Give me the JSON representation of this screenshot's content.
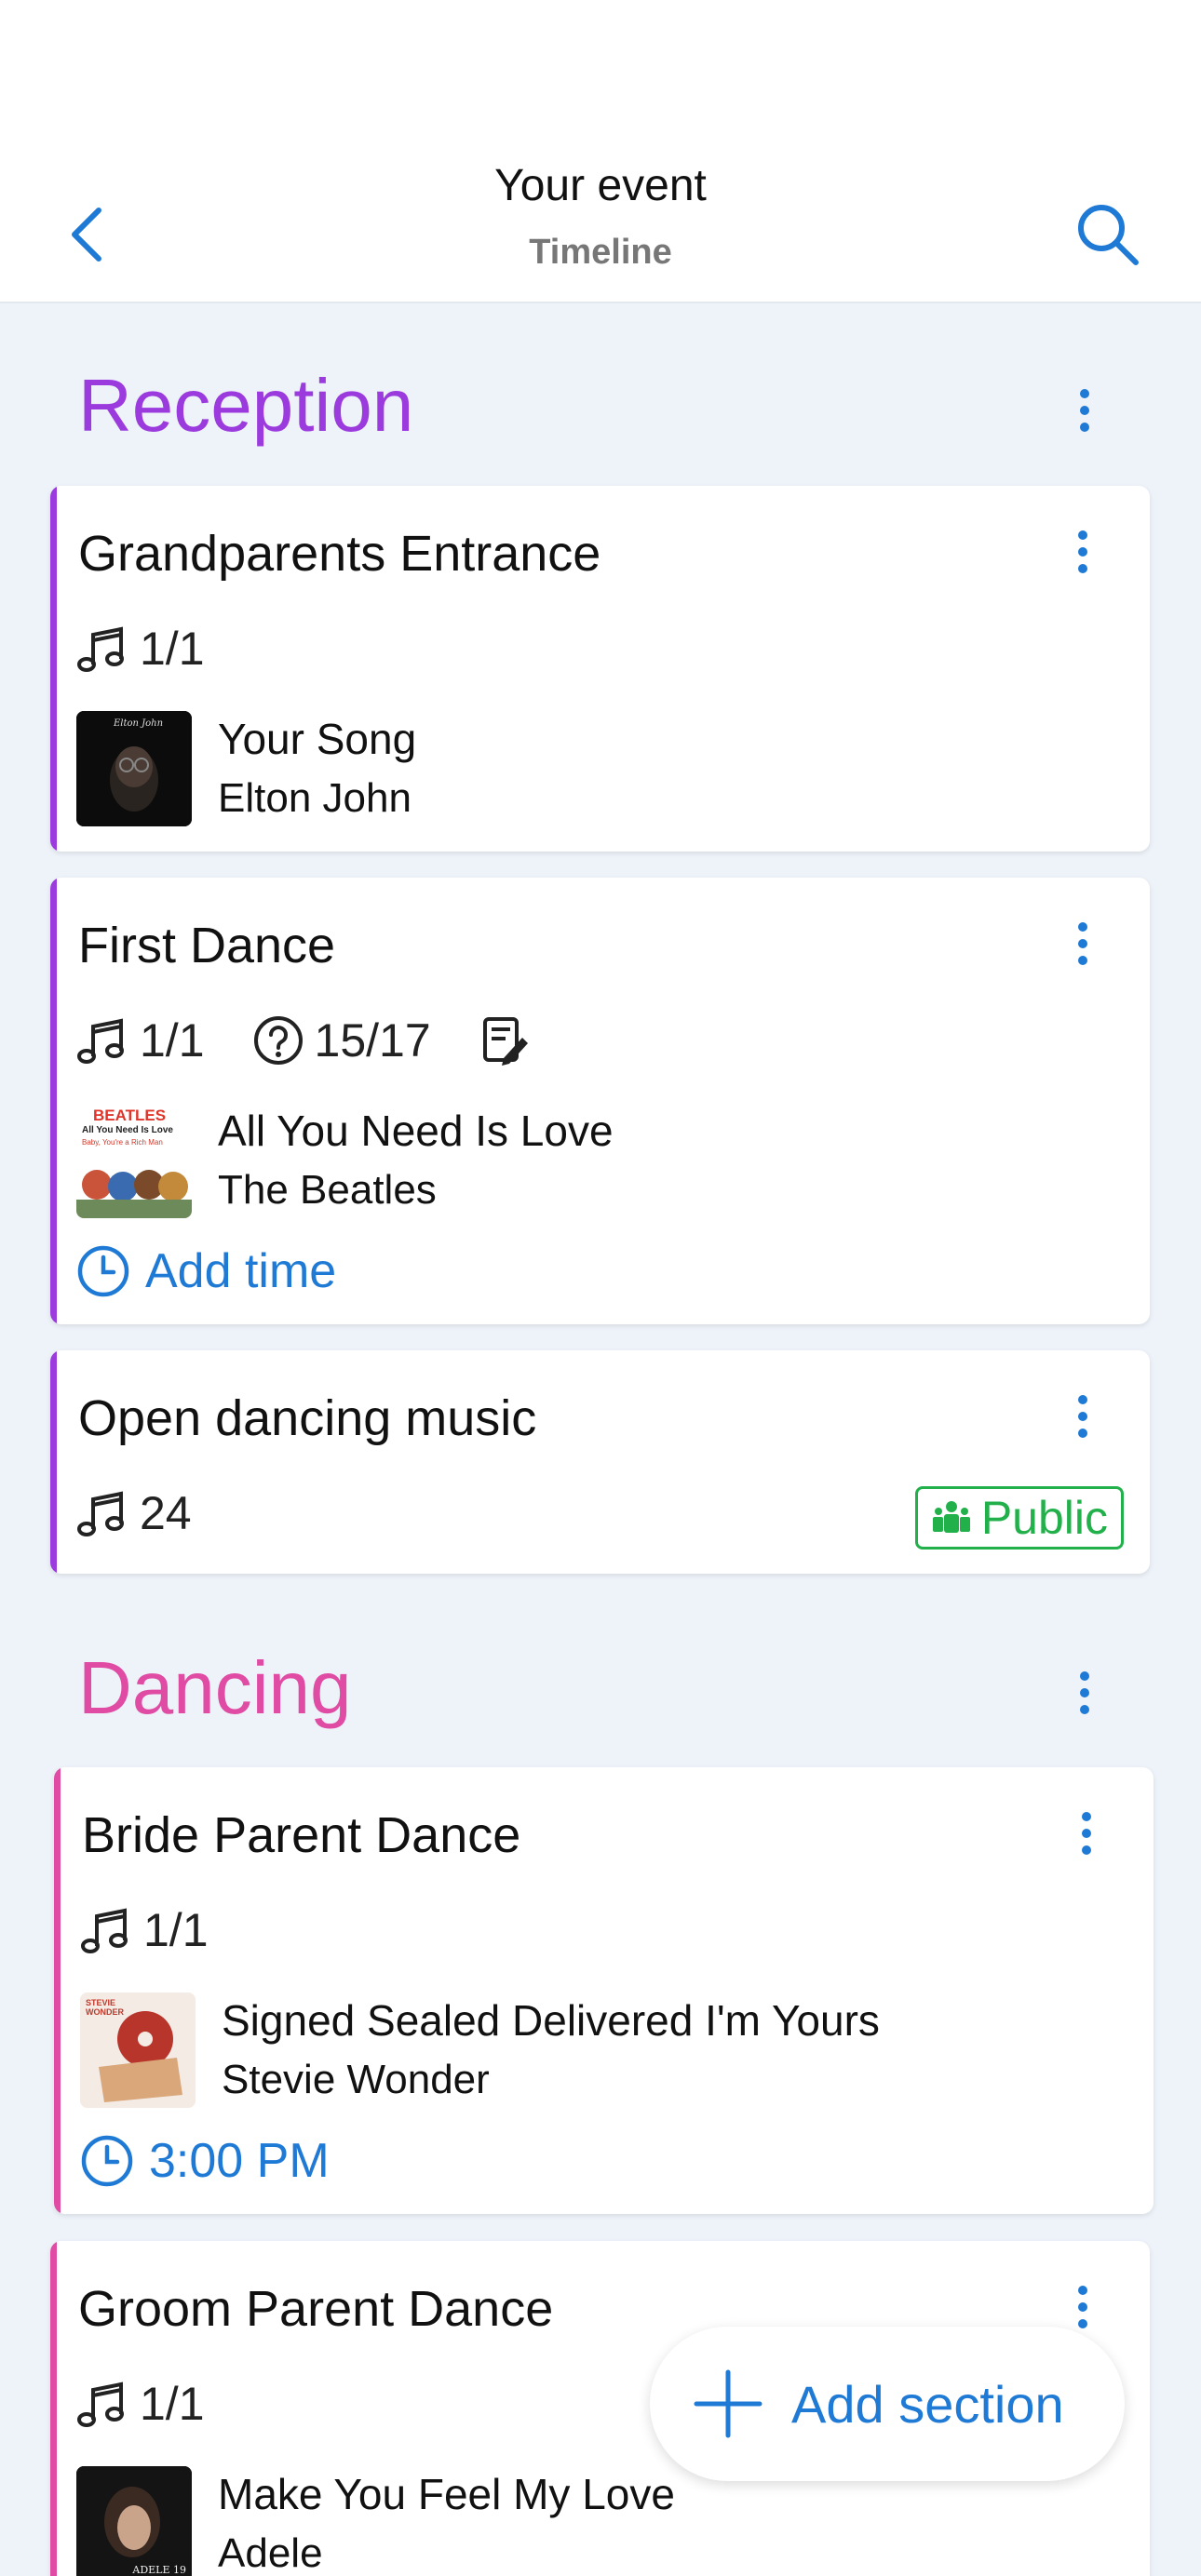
{
  "header": {
    "title": "Your event",
    "subtitle": "Timeline"
  },
  "colors": {
    "accent_blue": "#1f7ad6",
    "reception": "#9b3bde",
    "dancing": "#e04ba4",
    "public_green": "#22b04b"
  },
  "sections": [
    {
      "title": "Reception",
      "color": "#9b3bde",
      "items": [
        {
          "name": "Grandparents Entrance",
          "songs_count": "1/1",
          "song": {
            "title": "Your Song",
            "artist": "Elton John"
          }
        },
        {
          "name": "First Dance",
          "songs_count": "1/1",
          "questions": "15/17",
          "song": {
            "title": "All You Need Is Love",
            "artist": "The Beatles"
          },
          "time_label": "Add time"
        },
        {
          "name": "Open dancing music",
          "songs_count": "24",
          "badge": "Public"
        }
      ]
    },
    {
      "title": "Dancing",
      "color": "#e04ba4",
      "items": [
        {
          "name": "Bride Parent Dance",
          "songs_count": "1/1",
          "song": {
            "title": "Signed Sealed Delivered I'm Yours",
            "artist": "Stevie Wonder"
          },
          "time_label": "3:00 PM"
        },
        {
          "name": "Groom Parent Dance",
          "songs_count": "1/1",
          "song": {
            "title": "Make You Feel My Love",
            "artist": "Adele"
          }
        }
      ]
    }
  ],
  "album_art_text": {
    "elton": "Elton John",
    "beatles_band": "BEATLES",
    "beatles_album": "All You Need Is Love",
    "beatles_tagline": "Baby, You're a Rich Man",
    "stevie": "STEVIE WONDER",
    "adele": "ADELE 19"
  },
  "fab": {
    "label": "Add section"
  }
}
